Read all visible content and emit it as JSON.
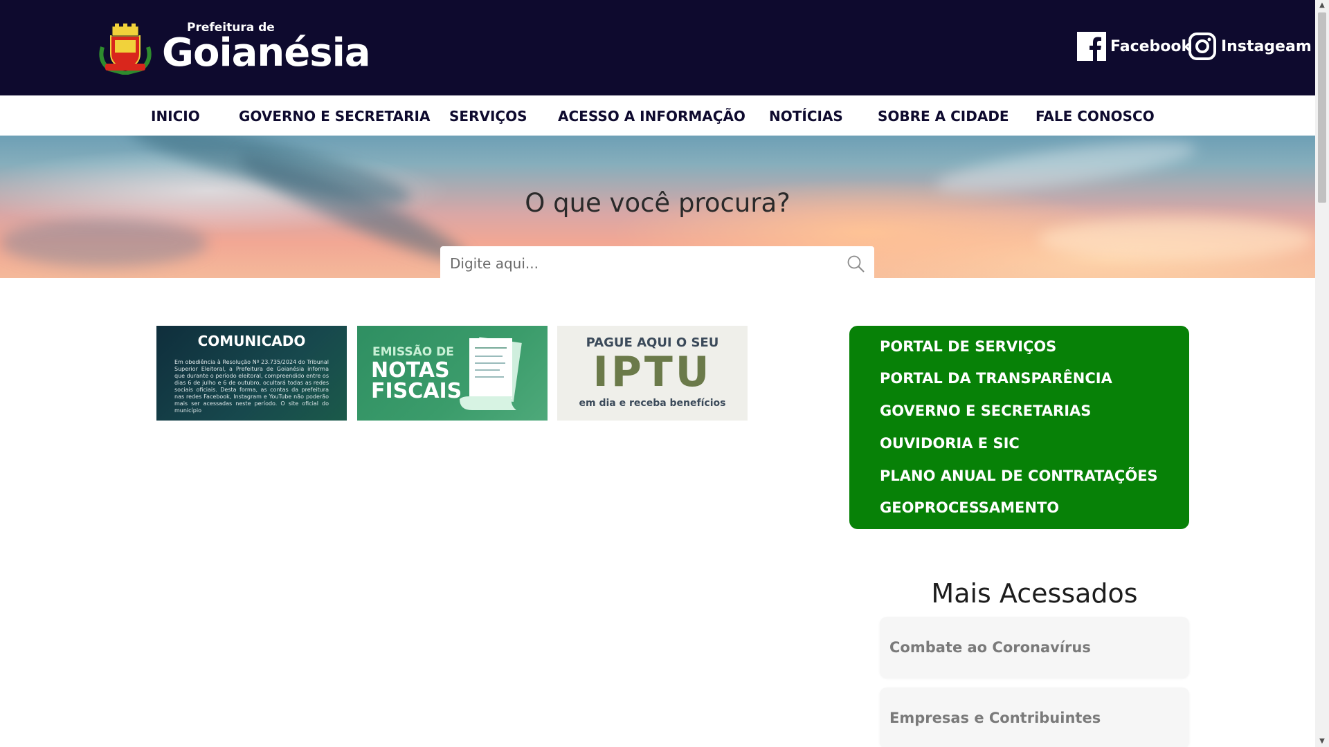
{
  "header": {
    "logo_small": "Prefeitura de",
    "logo_big": "Goianésia",
    "facebook_label": "Facebook",
    "instagram_label": "Instageam"
  },
  "nav": {
    "items": [
      "INICIO",
      "GOVERNO E SECRETARIA",
      "SERVIÇOS",
      "ACESSO A INFORMAÇÃO",
      "NOTÍCIAS",
      "SOBRE A CIDADE",
      "FALE CONOSCO"
    ]
  },
  "hero": {
    "title": "O que você procura?",
    "search_placeholder": "Digite aqui..."
  },
  "banners": {
    "comunicado": {
      "title": "COMUNICADO",
      "text": "Em obediência à Resolução Nº 23.735/2024 do Tribunal Superior Eleitoral, a Prefeitura de Goianésia informa que durante o período eleitoral, compreendido entre os dias 6 de julho e 6 de outubro, ocultará todas as redes sociais oficiais. Desta forma, as contas da prefeitura nas redes Facebook, Instagram e YouTube não poderão mais ser acessadas neste período. O site oficial do município"
    },
    "notas": {
      "line1": "EMISSÃO DE",
      "line2": "NOTAS",
      "line3": "FISCAIS"
    },
    "iptu": {
      "line1": "PAGUE AQUI O SEU",
      "line2": "IPTU",
      "line3": "em dia e receba benefícios"
    }
  },
  "quick_links": [
    "PORTAL DE SERVIÇOS",
    "PORTAL DA TRANSPARÊNCIA",
    "GOVERNO E SECRETARIAS",
    "OUVIDORIA E SIC",
    "PLANO ANUAL DE CONTRATAÇÕES",
    "GEOPROCESSAMENTO"
  ],
  "mais_acessados": {
    "title": "Mais Acessados",
    "items": [
      "Combate ao Coronavírus",
      "Empresas e Contribuintes"
    ]
  },
  "colors": {
    "header_bg": "#0e0a2e",
    "quick_bg": "#078107"
  }
}
